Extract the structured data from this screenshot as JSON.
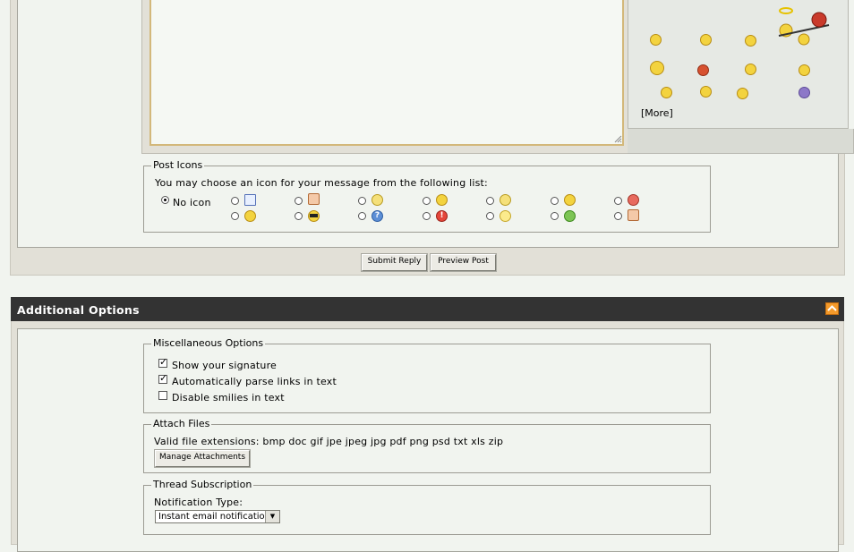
{
  "smilies": {
    "more_label": "[More]",
    "icons": [
      "waving-smilie-icon",
      "neutral-smilie-icon",
      "grin-smilie-icon",
      "angel-devil-seesaw-smilie-icon",
      "trophy-smilie-icon",
      "traffic-light-smilie-icon",
      "tongue-smilie-icon",
      "confused-smilie-icon",
      "reading-smilie-icon",
      "sleepy-smilie-icon",
      "tilted-smilie-icon",
      "sad-purple-smilie-icon"
    ]
  },
  "post_icons": {
    "legend": "Post Icons",
    "instruction": "You may choose an icon for your message from the following list:",
    "no_icon_label": "No icon",
    "selected": "No icon",
    "icons": [
      "document-icon",
      "thumbs-down-icon",
      "mad-face-icon",
      "smile-face-icon",
      "shocked-face-icon",
      "surprised-face-icon",
      "angry-face-icon",
      "wink-face-icon",
      "cool-face-icon",
      "question-icon",
      "exclamation-icon",
      "lightbulb-icon",
      "arrow-icon",
      "thumbs-up-icon"
    ]
  },
  "buttons": {
    "submit_reply": "Submit Reply",
    "preview_post": "Preview Post"
  },
  "additional_options": {
    "title": "Additional Options",
    "misc": {
      "legend": "Miscellaneous Options",
      "options": [
        {
          "label": "Show your signature",
          "checked": true
        },
        {
          "label": "Automatically parse links in text",
          "checked": true
        },
        {
          "label": "Disable smilies in text",
          "checked": false
        }
      ]
    },
    "attach": {
      "legend": "Attach Files",
      "extensions_text": "Valid file extensions: bmp doc gif jpe jpeg jpg pdf png psd txt xls zip",
      "manage_button": "Manage Attachments"
    },
    "subscription": {
      "legend": "Thread Subscription",
      "notification_label": "Notification Type:",
      "notification_value": "Instant email notification"
    }
  },
  "colors": {
    "header_bg": "#333333",
    "panel_bg": "#e2e0d7",
    "page_bg": "#f1f4ef",
    "textarea_border": "#d3b87a"
  }
}
